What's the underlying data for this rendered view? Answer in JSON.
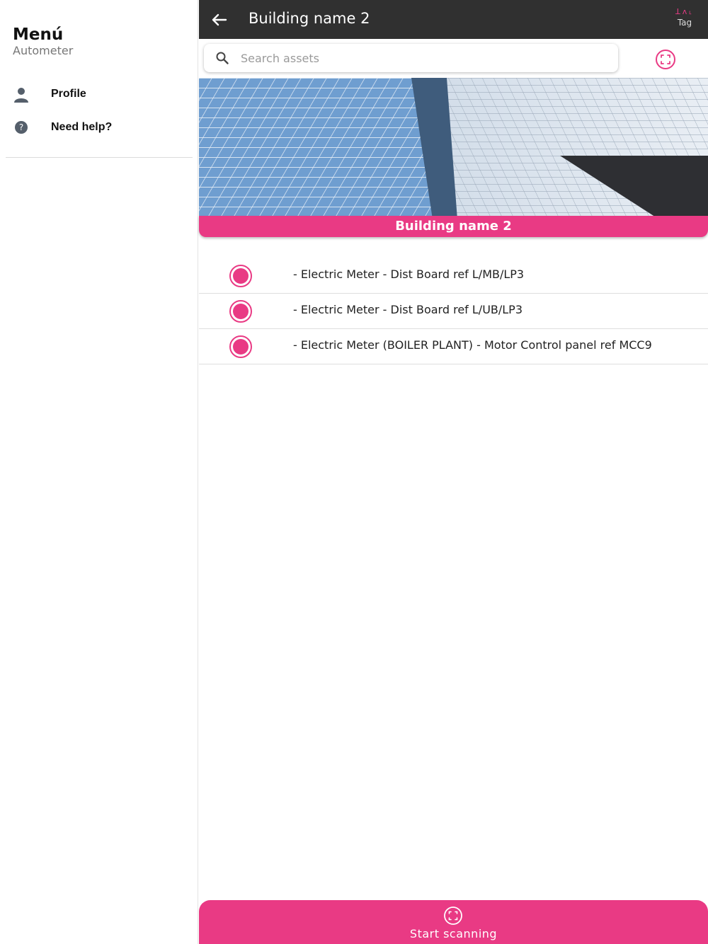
{
  "sidebar": {
    "title": "Menú",
    "subtitle": "Autometer",
    "items": [
      {
        "label": "Profile",
        "icon": "person-icon"
      },
      {
        "label": "Need help?",
        "icon": "help-icon"
      }
    ]
  },
  "appbar": {
    "title": "Building name 2",
    "brand_mark": "ꓕʌ˪",
    "brand_text": "Tag"
  },
  "search": {
    "placeholder": "Search assets",
    "value": ""
  },
  "building": {
    "name": "Building name 2"
  },
  "assets": [
    {
      "label": "- Electric Meter - Dist Board ref L/MB/LP3"
    },
    {
      "label": "- Electric Meter - Dist Board ref L/UB/LP3"
    },
    {
      "label": "- Electric Meter (BOILER PLANT) - Motor Control panel ref MCC9"
    }
  ],
  "footer": {
    "start_label": "Start scanning"
  },
  "colors": {
    "accent": "#e93a84",
    "appbar": "#303030"
  }
}
